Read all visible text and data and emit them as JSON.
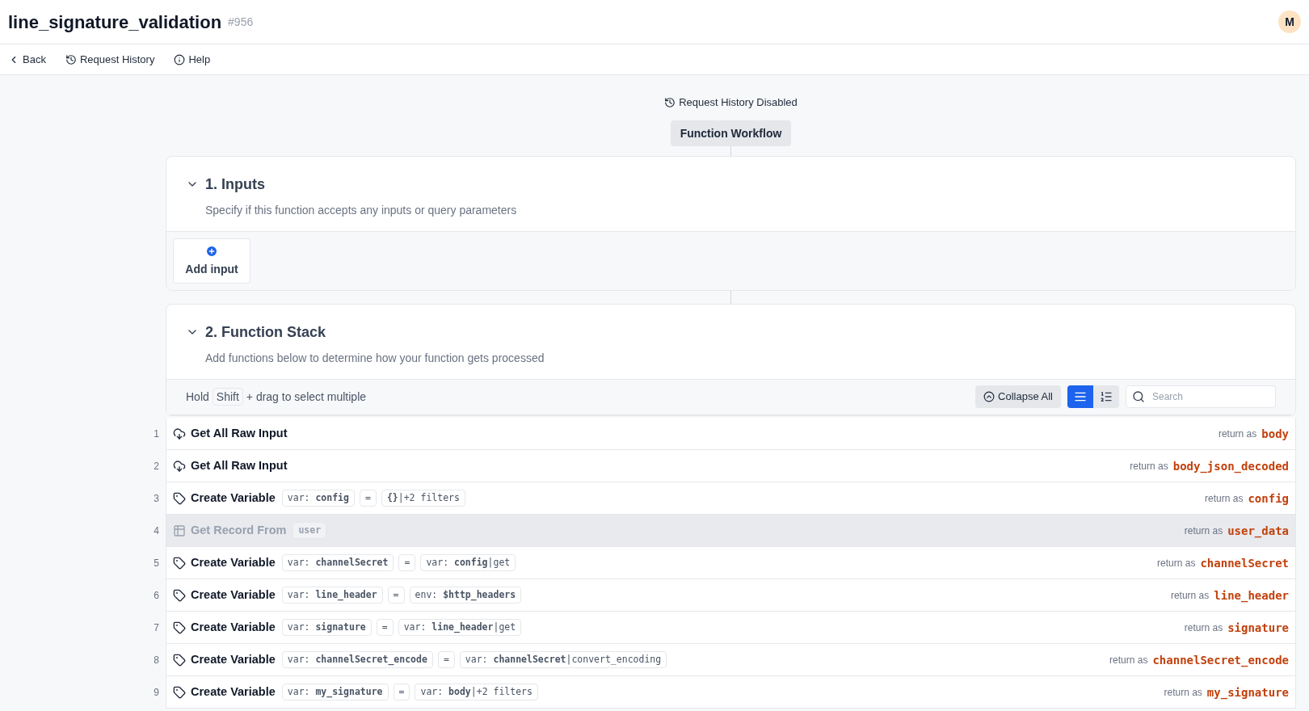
{
  "header": {
    "title": "line_signature_validation",
    "id": "#956",
    "avatar": "M"
  },
  "nav": [
    {
      "kind": "back",
      "label": "Back"
    },
    {
      "kind": "history",
      "label": "Request History"
    },
    {
      "kind": "help",
      "label": "Help"
    }
  ],
  "history_notice": "Request History Disabled",
  "workflow_label": "Function Workflow",
  "inputs": {
    "title": "1. Inputs",
    "expanded": true,
    "description": "Specify if this function accepts any inputs or query parameters",
    "add_label": "Add input"
  },
  "stack": {
    "title": "2. Function Stack",
    "expanded": true,
    "description": "Add functions below to determine how your function gets processed",
    "hint": {
      "before": "Hold",
      "key": "Shift",
      "after": "+ drag to select multiple"
    },
    "collapse_label": "Collapse All",
    "views": [
      {
        "kind": "list",
        "selected": true
      },
      {
        "kind": "numbered",
        "selected": false
      }
    ],
    "search": {
      "placeholder": "Search"
    },
    "steps": [
      {
        "number": "1",
        "kind": "input",
        "title": "Get All Raw Input",
        "disabled": false,
        "return_label": "return as",
        "returns": "body"
      },
      {
        "number": "2",
        "kind": "input",
        "title": "Get All Raw Input",
        "disabled": false,
        "return_label": "return as",
        "returns": "body_json_decoded"
      },
      {
        "number": "3",
        "kind": "variable",
        "title": "Create Variable",
        "disabled": false,
        "chips": [
          "var: **config**",
          "=",
          "**{}**|+2 filters"
        ],
        "return_label": "return as",
        "returns": "config"
      },
      {
        "number": "4",
        "kind": "record",
        "title": "Get Record From",
        "disabled": true,
        "chips": [
          "**user**"
        ],
        "return_label": "return as",
        "returns": "user_data"
      },
      {
        "number": "5",
        "kind": "variable",
        "title": "Create Variable",
        "disabled": false,
        "chips": [
          "var: **channelSecret**",
          "=",
          "var: **config**|get"
        ],
        "return_label": "return as",
        "returns": "channelSecret"
      },
      {
        "number": "6",
        "kind": "variable",
        "title": "Create Variable",
        "disabled": false,
        "chips": [
          "var: **line_header**",
          "=",
          "env: **$http_headers**"
        ],
        "return_label": "return as",
        "returns": "line_header"
      },
      {
        "number": "7",
        "kind": "variable",
        "title": "Create Variable",
        "disabled": false,
        "chips": [
          "var: **signature**",
          "=",
          "var: **line_header**|get"
        ],
        "return_label": "return as",
        "returns": "signature"
      },
      {
        "number": "8",
        "kind": "variable",
        "title": "Create Variable",
        "disabled": false,
        "chips": [
          "var: **channelSecret_encode**",
          "=",
          "var: **channelSecret**|convert_encoding"
        ],
        "return_label": "return as",
        "returns": "channelSecret_encode"
      },
      {
        "number": "9",
        "kind": "variable",
        "title": "Create Variable",
        "disabled": false,
        "chips": [
          "var: **my_signature**",
          "=",
          "var: **body**|+2 filters"
        ],
        "return_label": "return as",
        "returns": "my_signature"
      }
    ]
  }
}
